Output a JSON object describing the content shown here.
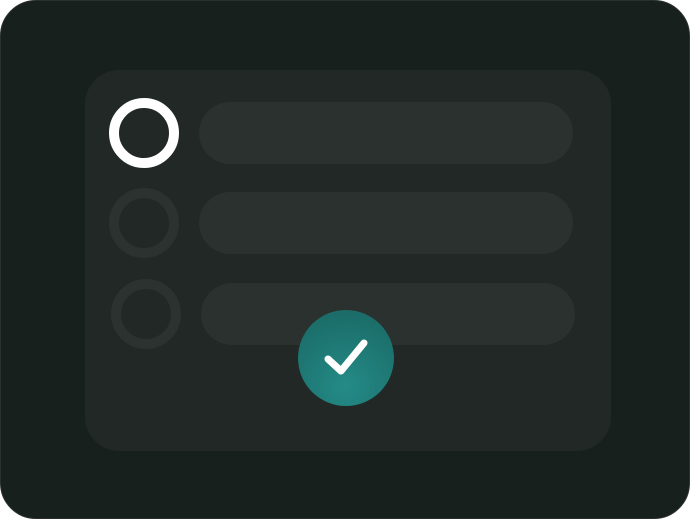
{
  "illustration": {
    "options": [
      {
        "state": "selected"
      },
      {
        "state": "unselected"
      },
      {
        "state": "unselected"
      }
    ],
    "confirm_icon": "checkmark-icon"
  },
  "colors": {
    "frame_background": "#18201d",
    "card_background": "#212826",
    "placeholder_line": "#2a312e",
    "inactive_radio": "#2b322f",
    "active_radio": "#ffffff",
    "check_badge": "#1e7672",
    "check_mark": "#ffffff"
  }
}
